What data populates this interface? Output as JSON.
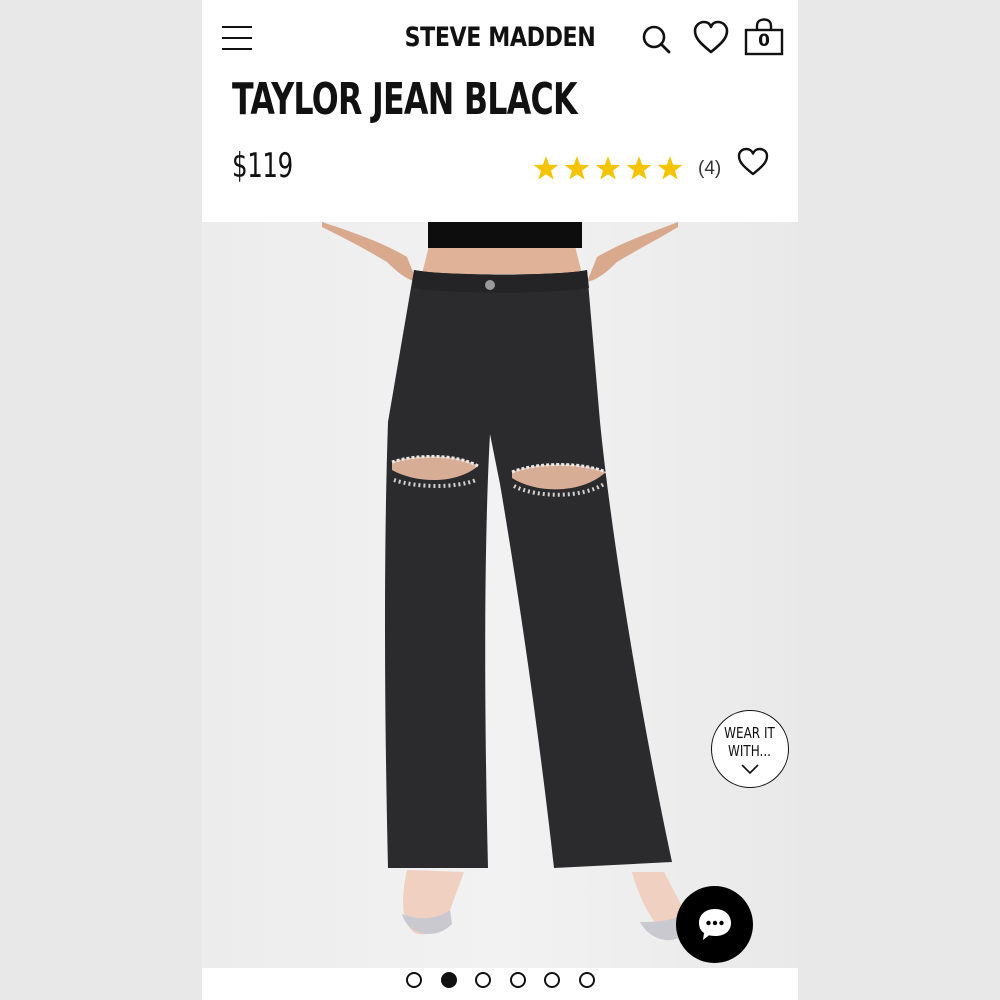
{
  "header": {
    "brand": "STEVE MADDEN",
    "cart_count": "0",
    "icons": [
      "menu-icon",
      "search-icon",
      "heart-icon",
      "shopping-bag-icon"
    ]
  },
  "product": {
    "title": "TAYLOR JEAN BLACK",
    "price": "$119",
    "rating": 5,
    "rating_max": 5,
    "review_count": "(4)",
    "star_color": "#f5c400"
  },
  "image": {
    "selected_index": 1,
    "total": 6
  },
  "wear_it": {
    "line1": "WEAR IT",
    "line2": "WITH..."
  },
  "chat": {
    "icon": "chat-bubble-icon"
  },
  "colors": {
    "text": "#111111",
    "denim": "#2b2b2d",
    "background": "#ffffff"
  }
}
